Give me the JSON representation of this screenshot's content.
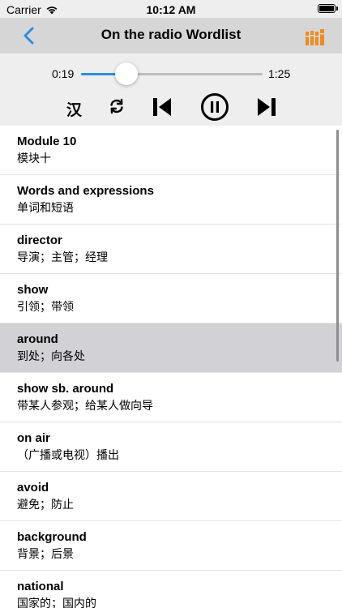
{
  "status_bar": {
    "carrier": "Carrier",
    "time": "10:12 AM"
  },
  "nav": {
    "title": "On the radio Wordlist",
    "back_icon": "chevron-left-icon",
    "list_icon": "books-icon",
    "accent_color": "#2b8fe0",
    "list_icon_color": "#f08a1c"
  },
  "player": {
    "current_time": "0:19",
    "total_time": "1:25",
    "progress": 0.25,
    "chinese_toggle_label": "汉",
    "controls": [
      "repeat-icon",
      "previous-icon",
      "pause-icon",
      "next-icon"
    ]
  },
  "words": [
    {
      "en": "Module 10",
      "cn": "模块十"
    },
    {
      "en": "Words and expressions",
      "cn": "单词和短语"
    },
    {
      "en": "director",
      "cn": "导演；主管；经理"
    },
    {
      "en": "show",
      "cn": "引领；带领"
    },
    {
      "en": "around",
      "cn": "到处；向各处",
      "selected": true
    },
    {
      "en": "show sb. around",
      "cn": "带某人参观；给某人做向导"
    },
    {
      "en": "on air",
      "cn": "（广播或电视）播出"
    },
    {
      "en": "avoid",
      "cn": "避免；防止"
    },
    {
      "en": "background",
      "cn": "背景；后景"
    },
    {
      "en": "national",
      "cn": "国家的；国内的"
    }
  ]
}
